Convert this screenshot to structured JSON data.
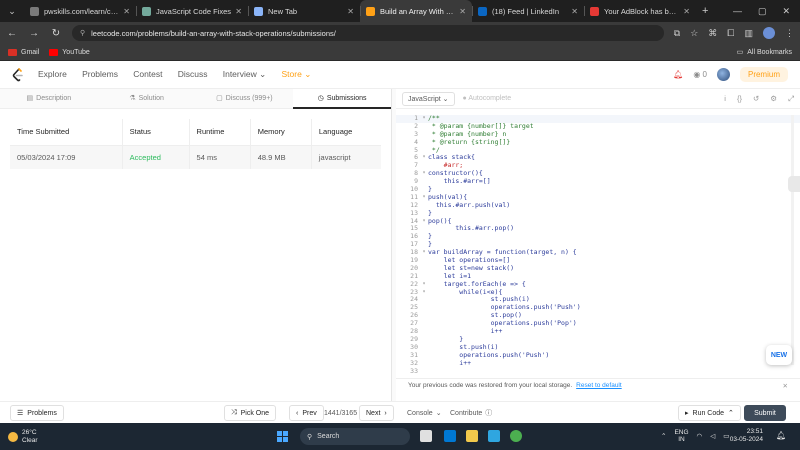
{
  "browser": {
    "tabs": [
      {
        "title": "pwskills.com/learn/course/",
        "favicon_color": "#7a7a7a",
        "active": false
      },
      {
        "title": "JavaScript Code Fixes",
        "favicon_color": "#74aa9c",
        "active": false
      },
      {
        "title": "New Tab",
        "favicon_color": "#8ab4f8",
        "active": false
      },
      {
        "title": "Build an Array With Stack O",
        "favicon_color": "#ffa116",
        "active": true
      },
      {
        "title": "(18) Feed | LinkedIn",
        "favicon_color": "#0a66c2",
        "active": false
      },
      {
        "title": "Your AdBlock has been up",
        "favicon_color": "#e53935",
        "active": false
      }
    ],
    "url": "leetcode.com/problems/build-an-array-with-stack-operations/submissions/",
    "bookmarks": [
      {
        "label": "Gmail",
        "icon": "gmail-icon",
        "color": "#d93025"
      },
      {
        "label": "YouTube",
        "icon": "youtube-icon",
        "color": "#ff0000"
      }
    ],
    "all_bookmarks": "All Bookmarks"
  },
  "header": {
    "nav": [
      "Explore",
      "Problems",
      "Contest",
      "Discuss",
      "Interview",
      "Store"
    ],
    "streak_count": "0",
    "premium": "Premium"
  },
  "left_tabs": [
    {
      "label": "Description",
      "icon": "document-icon"
    },
    {
      "label": "Solution",
      "icon": "flask-icon"
    },
    {
      "label": "Discuss (999+)",
      "icon": "chat-icon"
    },
    {
      "label": "Submissions",
      "icon": "clock-icon",
      "active": true
    }
  ],
  "submissions": {
    "columns": [
      "Time Submitted",
      "Status",
      "Runtime",
      "Memory",
      "Language"
    ],
    "rows": [
      {
        "time": "05/03/2024 17:09",
        "status": "Accepted",
        "runtime": "54 ms",
        "memory": "48.9 MB",
        "language": "javascript"
      }
    ]
  },
  "editor": {
    "language": "JavaScript",
    "autocomplete": "Autocomplete",
    "lines": [
      "/**",
      " * @param {number[]} target",
      " * @param {number} n",
      " * @return {string[]}",
      " */",
      "class stack{",
      "    #arr;",
      "constructor(){",
      "    this.#arr=[]",
      "}",
      "push(val){",
      "  this.#arr.push(val)",
      "}",
      "pop(){",
      "       this.#arr.pop()",
      "}",
      "}",
      "var buildArray = function(target, n) {",
      "    let operations=[]",
      "    let st=new stack()",
      "    let i=1",
      "    target.forEach(e => {",
      "        while(i<e){",
      "                st.push(i)",
      "                operations.push('Push')",
      "                st.pop()",
      "                operations.push('Pop')",
      "                i++",
      "        }",
      "        st.push(i)",
      "        operations.push('Push')",
      "        i++",
      ""
    ],
    "fold_lines": [
      1,
      6,
      8,
      11,
      14,
      18,
      22,
      23
    ]
  },
  "notice": {
    "text": "Your previous code was restored from your local storage.",
    "link": "Reset to default"
  },
  "floating": {
    "new_label": "NEW"
  },
  "bottom": {
    "problems": "Problems",
    "pick_one": "Pick One",
    "prev": "Prev",
    "page": "1441/3165",
    "next": "Next",
    "console": "Console",
    "contribute": "Contribute",
    "run_code": "Run Code",
    "submit": "Submit"
  },
  "taskbar": {
    "temp": "26°C",
    "weather": "Clear",
    "search": "Search",
    "lang1": "ENG",
    "lang2": "IN",
    "time": "23:51",
    "date": "03-05-2024"
  }
}
